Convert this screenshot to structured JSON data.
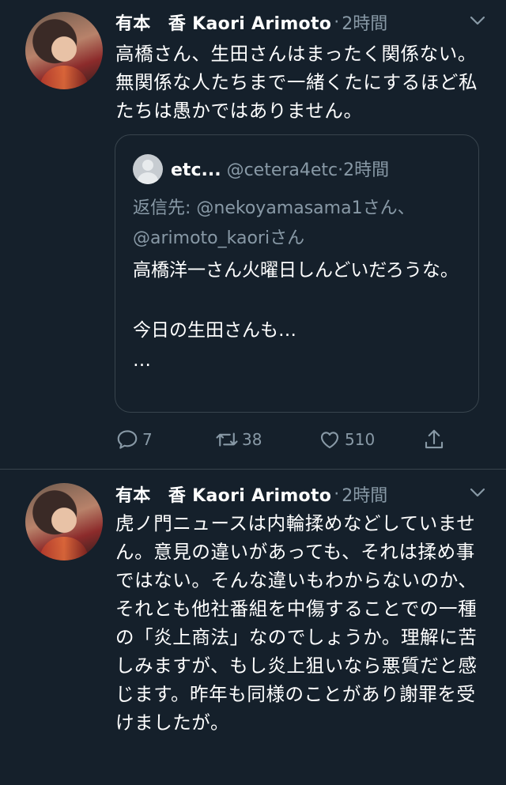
{
  "tweets": [
    {
      "author_name": "有本　香  Kaori Arimoto",
      "time": "2時間",
      "text": "高橋さん、生田さんはまったく関係ない。無関係な人たちまで一緒くたにするほど私たちは愚かではありません。",
      "quote": {
        "name": "etc...",
        "handle": "@cetera4etc",
        "time": "2時間",
        "reply_to": "返信先: @nekoyamasama1さん、@arimoto_kaoriさん",
        "text": "高橋洋一さん火曜日しんどいだろうな。\n\n今日の生田さんも…\n…"
      },
      "counts": {
        "replies": "7",
        "retweets": "38",
        "likes": "510"
      }
    },
    {
      "author_name": "有本　香  Kaori Arimoto",
      "time": "2時間",
      "text": "虎ノ門ニュースは内輪揉めなどしていません。意見の違いがあっても、それは揉め事ではない。そんな違いもわからないのか、それとも他社番組を中傷することでの一種の「炎上商法」なのでしょうか。理解に苦しみますが、もし炎上狙いなら悪質だと感じます。昨年も同様のことがあり謝罪を受けましたが。"
    }
  ],
  "icons": {
    "reply": "reply-icon",
    "retweet": "retweet-icon",
    "like": "heart-icon",
    "share": "share-icon",
    "menu": "chevron-down-icon"
  },
  "colors": {
    "background": "#15202b",
    "muted": "#8899a6",
    "border": "#38444d",
    "text": "#ffffff"
  }
}
